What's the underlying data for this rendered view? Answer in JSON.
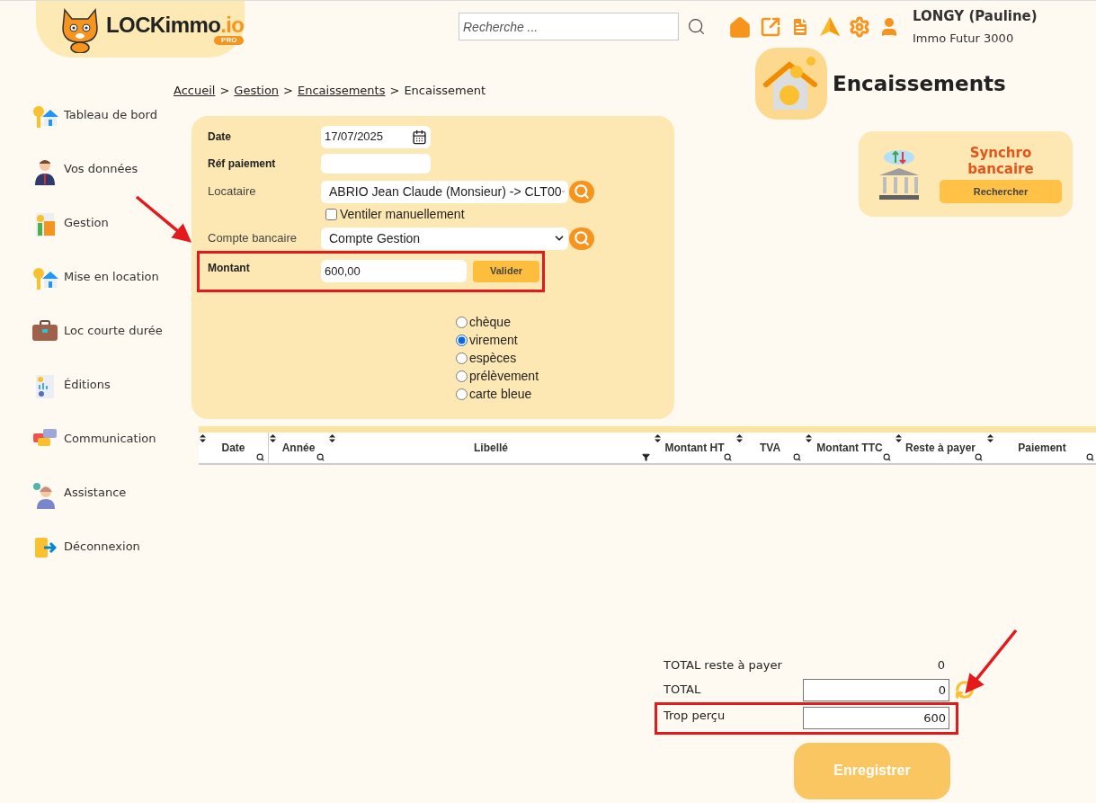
{
  "header": {
    "logo_text": "LOCKimmo",
    "logo_suffix": ".io",
    "logo_badge": "PRO",
    "search": {
      "placeholder": "Recherche ..."
    },
    "user": {
      "name": "LONGY (Pauline)",
      "company": "Immo Futur 3000"
    }
  },
  "sidebar": {
    "items": [
      {
        "label": "Tableau de bord",
        "kind": "keyhouse"
      },
      {
        "label": "Vos données",
        "kind": "person"
      },
      {
        "label": "Gestion",
        "kind": "calculator"
      },
      {
        "label": "Mise en location",
        "kind": "keyhouse"
      },
      {
        "label": "Loc courte durée",
        "kind": "suitcase"
      },
      {
        "label": "Éditions",
        "kind": "report"
      },
      {
        "label": "Communication",
        "kind": "chat"
      },
      {
        "label": "Assistance",
        "kind": "support"
      },
      {
        "label": "Déconnexion",
        "kind": "logout"
      }
    ]
  },
  "breadcrumb": [
    {
      "label": "Accueil",
      "link": true,
      "separator": ">"
    },
    {
      "label": "Gestion",
      "link": true,
      "separator": ">"
    },
    {
      "label": "Encaissements",
      "link": true,
      "separator": ">"
    },
    {
      "label": "Encaissement",
      "link": false
    }
  ],
  "page_title": "Encaissements",
  "sync_card": {
    "title": "Synchro bancaire",
    "button": "Rechercher"
  },
  "form": {
    "date": {
      "label": "Date",
      "value": "17/07/2025"
    },
    "reference": {
      "label": "Réf paiement"
    },
    "tenant": {
      "label": "Locataire",
      "value": "ABRIO Jean Claude (Monsieur) -> CLT00"
    },
    "manual_split": {
      "label": "Ventiler manuellement",
      "checked": false
    },
    "bank_account": {
      "label": "Compte bancaire",
      "value": "Compte Gestion"
    },
    "amount": {
      "label": "Montant",
      "value": "600,00",
      "button": "Valider"
    },
    "payment_methods": [
      {
        "label": "chèque",
        "selected": false
      },
      {
        "label": "virement",
        "selected": true
      },
      {
        "label": "espèces",
        "selected": false
      },
      {
        "label": "prélèvement",
        "selected": false
      },
      {
        "label": "carte bleue",
        "selected": false
      }
    ]
  },
  "table": {
    "columns": [
      {
        "label": "Date",
        "kind": "search"
      },
      {
        "label": "Année",
        "kind": "search"
      },
      {
        "label": "Libellé",
        "kind": "funnel"
      },
      {
        "label": "Montant HT",
        "kind": "search"
      },
      {
        "label": "TVA",
        "kind": "search"
      },
      {
        "label": "Montant TTC",
        "kind": "search"
      },
      {
        "label": "Reste à payer",
        "kind": "search"
      },
      {
        "label": "Paiement",
        "kind": "search"
      }
    ]
  },
  "totals": {
    "remaining": {
      "label": "TOTAL reste à payer",
      "value": "0"
    },
    "total": {
      "label": "TOTAL",
      "value": "0"
    },
    "overpaid": {
      "label": "Trop perçu",
      "value": "600"
    }
  },
  "save_button": "Enregistrer"
}
